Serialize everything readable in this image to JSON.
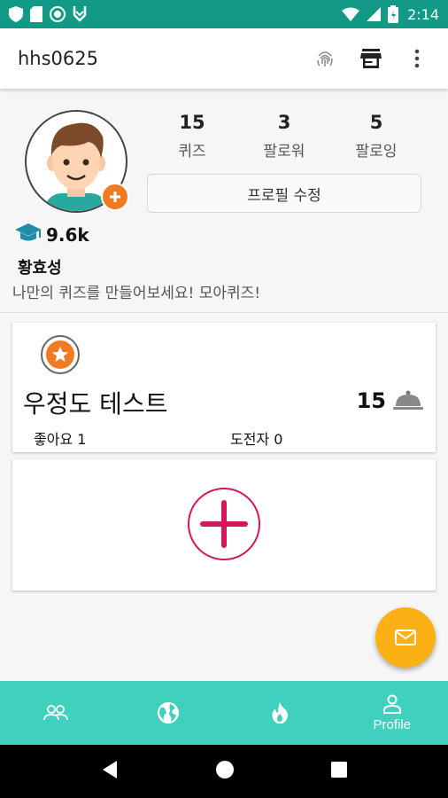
{
  "status_bar": {
    "time": "2:14",
    "background": "#129a86",
    "left_icons": [
      "shield-icon",
      "sim-card-icon",
      "record-icon",
      "download-icon"
    ],
    "right_icons": [
      "wifi-icon",
      "signal-icon",
      "battery-icon"
    ]
  },
  "app_bar": {
    "title": "hhs0625",
    "actions": [
      "fingerprint-icon",
      "store-icon",
      "more-vert-icon"
    ]
  },
  "profile": {
    "stats": [
      {
        "value": "15",
        "label": "퀴즈"
      },
      {
        "value": "3",
        "label": "팔로워"
      },
      {
        "value": "5",
        "label": "팔로잉"
      }
    ],
    "edit_label": "프로필 수정",
    "score": "9.6k",
    "name": "황효성",
    "bio": "나만의 퀴즈를 만들어보세요! 모아퀴즈!"
  },
  "quiz_card": {
    "title": "우정도 테스트",
    "count": "15",
    "likes": "좋아요 1",
    "challengers": "도전자 0"
  },
  "bottom_nav": {
    "items": [
      {
        "icon": "people-icon",
        "label": ""
      },
      {
        "icon": "globe-icon",
        "label": ""
      },
      {
        "icon": "fire-icon",
        "label": ""
      },
      {
        "icon": "person-icon",
        "label": "Profile"
      }
    ],
    "background": "#3fd1bd"
  },
  "colors": {
    "accent_orange": "#f07b22",
    "fab_yellow": "#fbb016",
    "add_pink": "#d3175a"
  }
}
